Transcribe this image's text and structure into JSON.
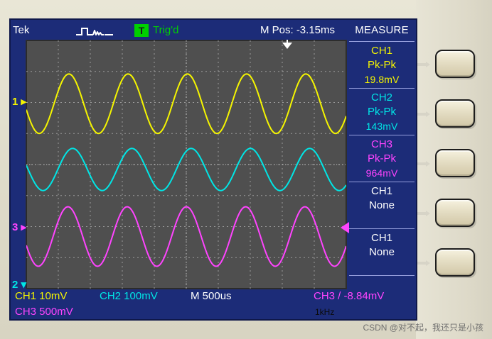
{
  "status_bar": {
    "brand": "Tek",
    "trigger_badge": "T",
    "trigger_status": "Trig'd",
    "main_position": "M Pos: -3.15ms"
  },
  "measure": {
    "title": "MEASURE",
    "items": [
      {
        "title": "CH1",
        "sub": "Pk-Pk",
        "value": "19.8mV",
        "color": "#f5f500"
      },
      {
        "title": "CH2",
        "sub": "Pk-Pk",
        "value": "143mV",
        "color": "#00e6e6"
      },
      {
        "title": "CH3",
        "sub": "Pk-Pk",
        "value": "964mV",
        "color": "#ff44ff"
      },
      {
        "title": "CH1",
        "sub": "None",
        "value": "",
        "color": "#ffffff"
      },
      {
        "title": "CH1",
        "sub": "None",
        "value": "",
        "color": "#ffffff"
      }
    ]
  },
  "markers": {
    "ch1": "1",
    "ch3": "3",
    "ch2": "2"
  },
  "bottom": {
    "ch1_scale": "CH1 10mV",
    "ch2_scale": "CH2 100mV",
    "timebase": "M 500us",
    "ch3_trigger": "CH3 / -8.84mV",
    "ch3_scale": "CH3 500mV",
    "freq": "1kHz"
  },
  "watermark": "CSDN @对不起，我还只是小孩",
  "colors": {
    "screen_bg": "#1c2c78",
    "plot_bg": "#4f4f4f",
    "ch1": "#f5f500",
    "ch2": "#00e6e6",
    "ch3": "#ff44ff",
    "trig_green": "#00d000"
  },
  "icons": {
    "acquisition": "acquisition-waveform-icon",
    "trigger_position": "trigger-position-arrow-icon",
    "ch1_marker": "ch1-ground-marker-icon",
    "ch2_marker": "ch2-ground-marker-icon",
    "ch3_marker": "ch3-ground-marker-icon",
    "trigger_level": "trigger-level-marker-icon",
    "trigger_slope": "rising-edge-icon"
  }
}
